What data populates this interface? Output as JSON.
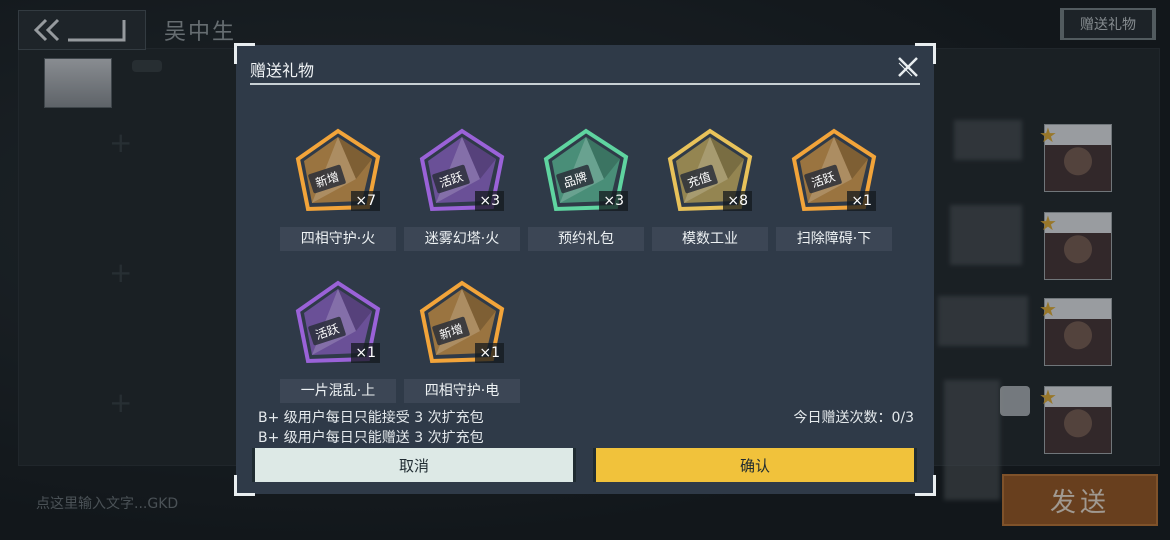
{
  "header": {
    "peer_name": "吴中生",
    "gift_button_label": "赠送礼物"
  },
  "chat": {
    "input_placeholder": "点这里输入文字...GKD",
    "send_label": "发送"
  },
  "modal": {
    "title": "赠送礼物",
    "gifts": [
      {
        "name": "四相守护·火",
        "count": "×7",
        "badge": "新增",
        "color": "#f2a43a"
      },
      {
        "name": "迷雾幻塔·火",
        "count": "×3",
        "badge": "活跃",
        "color": "#9a62d8"
      },
      {
        "name": "预约礼包",
        "count": "×3",
        "badge": "品牌",
        "color": "#5fd4a0"
      },
      {
        "name": "模数工业",
        "count": "×8",
        "badge": "充值",
        "color": "#e8c25a"
      },
      {
        "name": "扫除障碍·下",
        "count": "×1",
        "badge": "活跃",
        "color": "#f2a43a"
      },
      {
        "name": "一片混乱·上",
        "count": "×1",
        "badge": "活跃",
        "color": "#9a62d8"
      },
      {
        "name": "四相守护·电",
        "count": "×1",
        "badge": "新增",
        "color": "#f2a43a"
      }
    ],
    "rules": [
      "B+ 级用户每日只能接受 3 次扩充包",
      "B+ 级用户每日只能赠送 3 次扩充包"
    ],
    "daily_count": "今日赠送次数：0/3",
    "cancel_label": "取消",
    "confirm_label": "确认"
  },
  "colors": {
    "accent": "#f1c23b",
    "cancel_bg": "#dde9e6",
    "send_bg": "#9d5d27"
  }
}
